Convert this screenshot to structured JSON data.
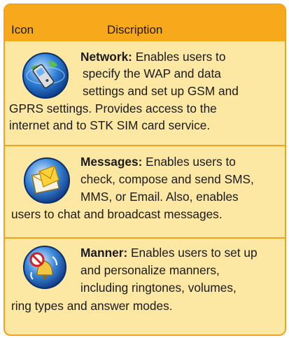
{
  "header": {
    "icon_col": "Icon",
    "desc_col": "Discription"
  },
  "entries": [
    {
      "icon": "network-globe-phone-icon",
      "title": "Network:",
      "lines": [
        " Enables users to",
        "specify the WAP and data",
        "settings and set up GSM and",
        "GPRS settings. Provides access to the",
        "internet and to STK SIM card service."
      ]
    },
    {
      "icon": "messages-envelope-icon",
      "title": "Messages:",
      "lines": [
        " Enables users to",
        "check, compose and send SMS,",
        "MMS, or Email. Also, enables",
        "users to chat and broadcast messages."
      ]
    },
    {
      "icon": "manner-bell-icon",
      "title": "Manner:",
      "lines": [
        " Enables users to set up",
        "and personalize manners,",
        "including ringtones, volumes,",
        "ring types and answer modes."
      ]
    }
  ],
  "colors": {
    "header": "#f7a81b",
    "body": "#fde8a3",
    "border": "#f2a21c"
  }
}
